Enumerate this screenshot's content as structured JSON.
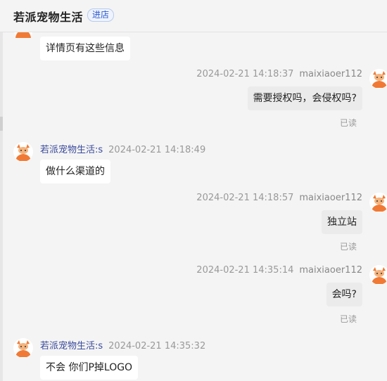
{
  "header": {
    "shop_name": "若派宠物生活",
    "enter_shop_label": "进店"
  },
  "messages": [
    {
      "text": "详情页有这些信息"
    },
    {
      "time": "2024-02-21 14:18:37",
      "user": "maixiaoer112",
      "text": "需要授权吗，会侵权吗?",
      "status": "已读"
    },
    {
      "sender": "若派宠物生活:s",
      "time": "2024-02-21 14:18:49",
      "text": "做什么渠道的"
    },
    {
      "time": "2024-02-21 14:18:57",
      "user": "maixiaoer112",
      "text": "独立站",
      "status": "已读"
    },
    {
      "time": "2024-02-21 14:35:14",
      "user": "maixiaoer112",
      "text": "会吗?",
      "status": "已读"
    },
    {
      "sender": "若派宠物生活:s",
      "time": "2024-02-21 14:35:32",
      "text": "不会  你们P掉LOGO"
    }
  ],
  "colors": {
    "background": "#f4f4f4",
    "incoming_bubble": "#ffffff",
    "outgoing_bubble": "#ebebeb",
    "sender_name": "#3a4a9c",
    "accent": "#2f5bd0",
    "avatar_orange": "#f07a35"
  },
  "icons": {
    "avatar": "cartoon-pet-avatar-icon"
  }
}
